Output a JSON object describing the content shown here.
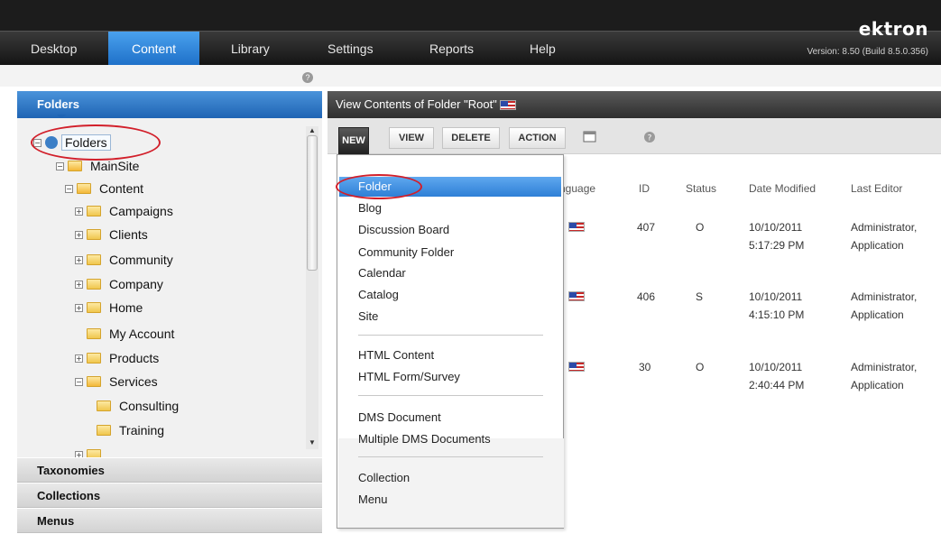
{
  "nav": {
    "items": [
      "Desktop",
      "Content",
      "Library",
      "Settings",
      "Reports",
      "Help"
    ],
    "active": "Content",
    "brand": "ektron",
    "version": "Version: 8.50 (Build 8.5.0.356)"
  },
  "left_panel": {
    "header": "Folders",
    "tree": [
      {
        "label": "Folders",
        "level": 0,
        "icon": "home-icon",
        "expander": "minus"
      },
      {
        "label": "MainSite",
        "level": 1,
        "icon": "folder-open-icon",
        "expander": "minus"
      },
      {
        "label": "Content",
        "level": 2,
        "icon": "folder-open-icon",
        "expander": "minus"
      },
      {
        "label": "Campaigns",
        "level": 3,
        "icon": "folder-icon",
        "expander": "plus"
      },
      {
        "label": "Clients",
        "level": 3,
        "icon": "folder-icon",
        "expander": "plus"
      },
      {
        "label": "Community",
        "level": 3,
        "icon": "folder-icon",
        "expander": "plus"
      },
      {
        "label": "Company",
        "level": 3,
        "icon": "folder-icon",
        "expander": "plus"
      },
      {
        "label": "Home",
        "level": 3,
        "icon": "folder-icon",
        "expander": "plus"
      },
      {
        "label": "My Account",
        "level": 3,
        "icon": "folder-icon",
        "expander": "none"
      },
      {
        "label": "Products",
        "level": 3,
        "icon": "folder-icon",
        "expander": "plus"
      },
      {
        "label": "Services",
        "level": 3,
        "icon": "folder-open-icon",
        "expander": "minus"
      },
      {
        "label": "Consulting",
        "level": 4,
        "icon": "folder-icon",
        "expander": "none"
      },
      {
        "label": "Training",
        "level": 4,
        "icon": "folder-icon",
        "expander": "none"
      }
    ],
    "sections": [
      "Taxonomies",
      "Collections",
      "Menus"
    ]
  },
  "right_panel": {
    "header": "View Contents of Folder \"Root\"",
    "toolbar": {
      "new": "NEW",
      "view": "VIEW",
      "delete": "DELETE",
      "action": "ACTION"
    },
    "columns": {
      "language": "nguage",
      "id": "ID",
      "status": "Status",
      "date_modified": "Date Modified",
      "last_editor": "Last Editor"
    },
    "rows": [
      {
        "id": "407",
        "status": "O",
        "date": "10/10/2011",
        "time": "5:17:29 PM",
        "editor1": "Administrator,",
        "editor2": "Application"
      },
      {
        "id": "406",
        "status": "S",
        "date": "10/10/2011",
        "time": "4:15:10 PM",
        "editor1": "Administrator,",
        "editor2": "Application"
      },
      {
        "id": "30",
        "status": "O",
        "date": "10/10/2011",
        "time": "2:40:44 PM",
        "editor1": "Administrator,",
        "editor2": "Application"
      }
    ]
  },
  "new_menu": {
    "group1": [
      "Folder",
      "Blog",
      "Discussion Board",
      "Community Folder",
      "Calendar",
      "Catalog",
      "Site"
    ],
    "group2": [
      "HTML Content",
      "HTML Form/Survey"
    ],
    "group3": [
      "DMS Document",
      "Multiple DMS Documents"
    ],
    "group4": [
      "Collection",
      "Menu"
    ],
    "highlighted": "Folder"
  },
  "colors": {
    "accent": "#2e7fd6",
    "annotation": "#d21f2a"
  }
}
